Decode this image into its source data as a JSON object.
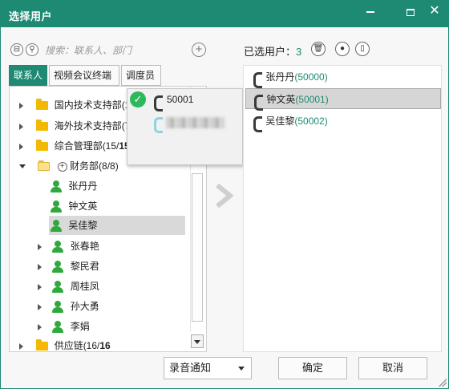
{
  "window": {
    "title": "选择用户"
  },
  "search": {
    "placeholder": "搜索：联系人、部门"
  },
  "tabs": [
    "联系人",
    "视频会议终端",
    "调度员"
  ],
  "tree": {
    "groups_top": [
      {
        "label": "国内技术支持部(1",
        "bold": ""
      },
      {
        "label": "海外技术支持部(7,",
        "bold": ""
      },
      {
        "label": "综合管理部(15/",
        "bold": "15"
      }
    ],
    "open_group": "财务部(8/8)",
    "members": [
      "张丹丹",
      "钟文英",
      "吴佳黎",
      "张春艳",
      "黎民君",
      "周桂凤",
      "孙大勇",
      "李娟"
    ],
    "bottom_group": {
      "label": "供应链(16/",
      "bold": "16"
    }
  },
  "popup": {
    "number": "50001"
  },
  "right": {
    "header_label": "已选用户：",
    "count": "3",
    "items": [
      {
        "name": "张丹丹",
        "ext": "(50000)"
      },
      {
        "name": "钟文英",
        "ext": "(50001)"
      },
      {
        "name": "吴佳黎",
        "ext": "(50002)"
      }
    ]
  },
  "footer": {
    "dropdown_value": "录音通知",
    "ok": "确定",
    "cancel": "取消"
  },
  "colors": {
    "accent": "#1e8a73",
    "person": "#2eaa3c",
    "check": "#2eb85c"
  }
}
